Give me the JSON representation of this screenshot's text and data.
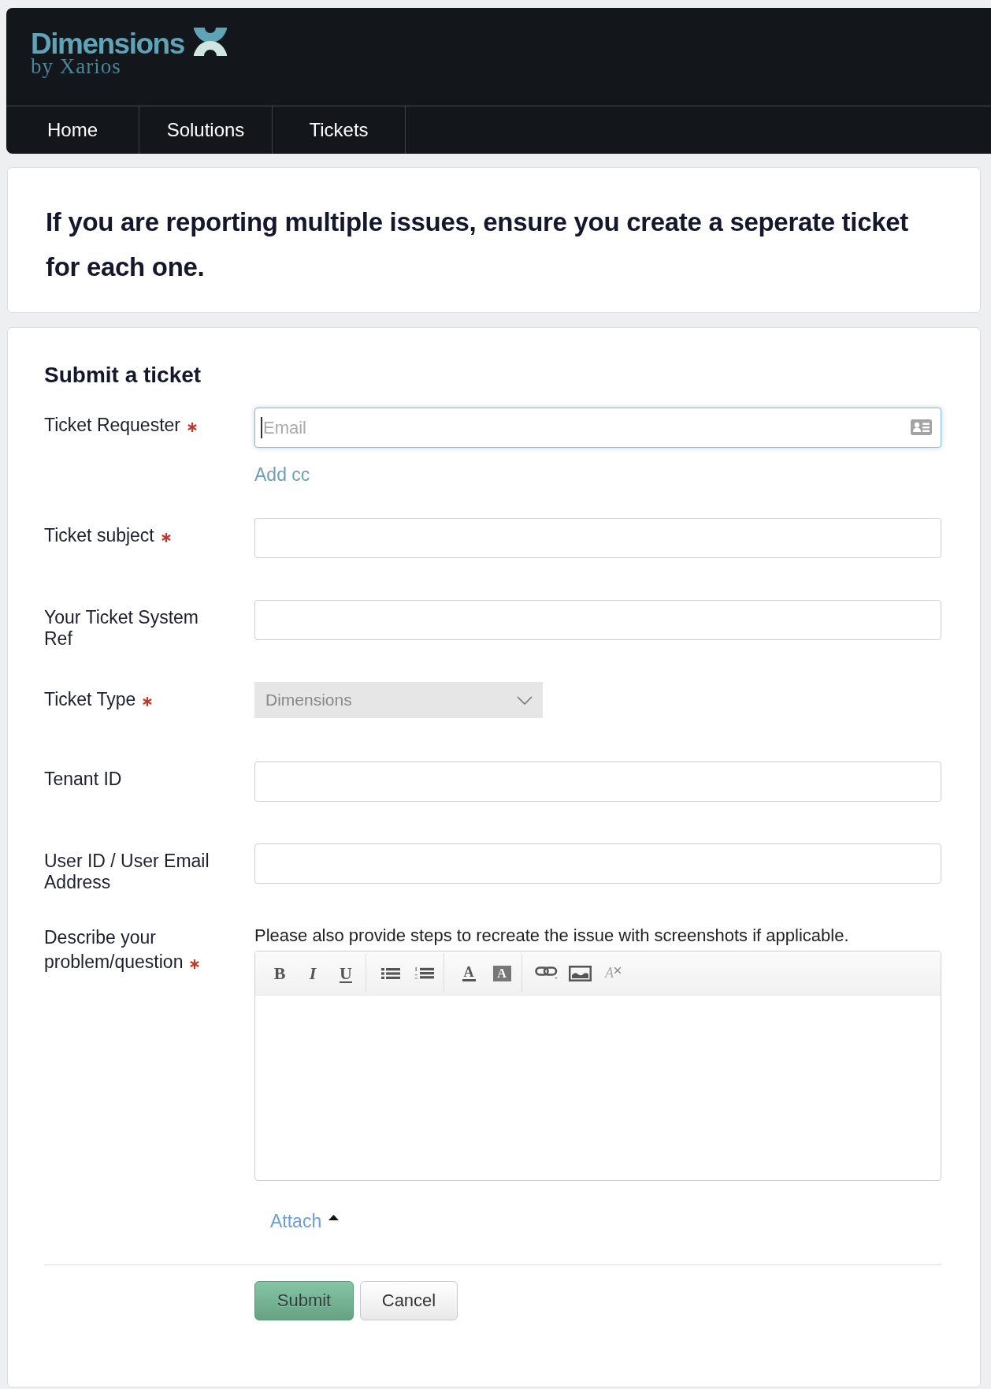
{
  "header": {
    "logo": {
      "name": "Dimensions",
      "tagline": "by Xarios"
    },
    "nav": [
      {
        "label": "Home"
      },
      {
        "label": "Solutions"
      },
      {
        "label": "Tickets"
      }
    ]
  },
  "notice": "If you are reporting multiple issues, ensure you create a seperate ticket for each one.",
  "form": {
    "title": "Submit a ticket",
    "fields": [
      {
        "kind": "email",
        "label": "Ticket Requester",
        "required": true,
        "placeholder": "Email",
        "focused": true,
        "link": "Add cc"
      },
      {
        "kind": "text",
        "label": "Ticket subject",
        "required": true
      },
      {
        "kind": "text",
        "label": "Your Ticket System Ref",
        "required": false
      },
      {
        "kind": "select",
        "label": "Ticket Type",
        "required": true,
        "value": "Dimensions"
      },
      {
        "kind": "text",
        "label": "Tenant ID",
        "required": false
      },
      {
        "kind": "text",
        "label": "User ID / User Email Address",
        "required": false
      },
      {
        "kind": "editor",
        "label": "Describe your problem/question",
        "required": true,
        "hint": "Please also provide steps to recreate the issue with screenshots if applicable.",
        "toolbar": [
          [
            {
              "kind": "bold",
              "label": "B"
            },
            {
              "kind": "italic",
              "label": "I"
            },
            {
              "kind": "underline",
              "label": "U"
            }
          ],
          [
            {
              "kind": "bullet-list"
            },
            {
              "kind": "numbered-list"
            }
          ],
          [
            {
              "kind": "text-color",
              "label": "A"
            },
            {
              "kind": "background-color",
              "label": "A"
            }
          ],
          [
            {
              "kind": "link"
            },
            {
              "kind": "image"
            },
            {
              "kind": "clear-format",
              "label": "A"
            }
          ]
        ],
        "attach": "Attach"
      }
    ],
    "buttons": [
      {
        "kind": "primary",
        "label": "Submit"
      },
      {
        "kind": "secondary",
        "label": "Cancel"
      }
    ]
  }
}
